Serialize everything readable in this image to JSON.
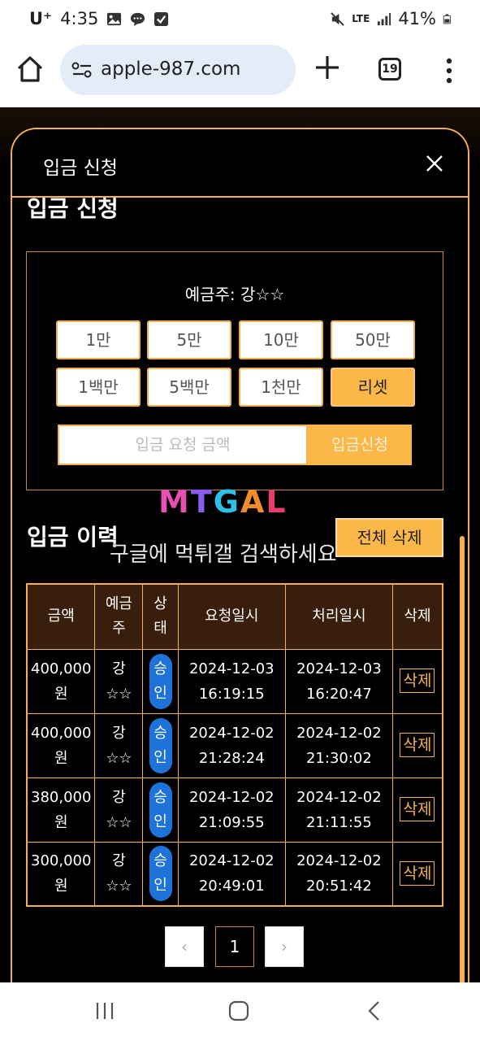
{
  "status_bar": {
    "carrier": "U⁺",
    "time": "4:35",
    "network": "LTE",
    "battery": "41%"
  },
  "browser": {
    "url": "apple-987.com",
    "tab_count": "19"
  },
  "modal": {
    "title": "입금 신청",
    "section_title": "입금 신청",
    "depositor": "예금주: 강☆☆",
    "amount_buttons": [
      "1만",
      "5만",
      "10만",
      "50만",
      "1백만",
      "5백만",
      "1천만",
      "리셋"
    ],
    "amount_placeholder": "입금 요청 금액",
    "apply_label": "입금신청",
    "history_title": "입금 이력",
    "delete_all_label": "전체 삭제",
    "watermark_logo": "MTGAL",
    "watermark_text": "구글에 먹튀갤 검색하세요",
    "table": {
      "headers": [
        "금액",
        "예금주",
        "상태",
        "요청일시",
        "처리일시",
        "삭제"
      ],
      "rows": [
        {
          "amount": "400,000원",
          "name": "강☆☆",
          "status": "승인",
          "requested": "2024-12-03 16:19:15",
          "processed": "2024-12-03 16:20:47",
          "delete": "삭제"
        },
        {
          "amount": "400,000원",
          "name": "강☆☆",
          "status": "승인",
          "requested": "2024-12-02 21:28:24",
          "processed": "2024-12-02 21:30:02",
          "delete": "삭제"
        },
        {
          "amount": "380,000원",
          "name": "강☆☆",
          "status": "승인",
          "requested": "2024-12-02 21:09:55",
          "processed": "2024-12-02 21:11:55",
          "delete": "삭제"
        },
        {
          "amount": "300,000원",
          "name": "강☆☆",
          "status": "승인",
          "requested": "2024-12-02 20:49:01",
          "processed": "2024-12-02 20:51:42",
          "delete": "삭제"
        }
      ]
    },
    "pager": {
      "prev": "‹",
      "current": "1",
      "next": "›"
    }
  }
}
